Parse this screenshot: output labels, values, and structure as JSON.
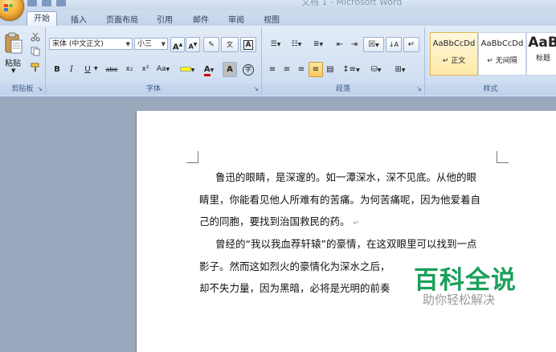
{
  "title": "文档 1 - Microsoft Word",
  "tabs": [
    "开始",
    "插入",
    "页面布局",
    "引用",
    "邮件",
    "审阅",
    "视图"
  ],
  "clipboard": {
    "paste": "粘贴",
    "group": "剪贴板"
  },
  "font": {
    "name": "宋体 (中文正文)",
    "size": "小三",
    "grow": "A",
    "shrink": "A",
    "bold": "B",
    "italic": "I",
    "underline": "U",
    "strike": "abe",
    "subscript": "x₂",
    "superscript": "x²",
    "change_case": "Aa",
    "font_color": "A",
    "char_shading": "A",
    "group": "字体"
  },
  "paragraph": {
    "group": "段落"
  },
  "styles": {
    "items": [
      {
        "sample": "AaBbCcDd",
        "name": "↵ 正文"
      },
      {
        "sample": "AaBbCcDd",
        "name": "↵ 无间隔"
      },
      {
        "sample": "AaB",
        "name": "标题"
      }
    ],
    "group": "样式"
  },
  "document": {
    "lines": [
      "鲁迅的眼睛，是深邃的。如一潭深水，深不见底。从他的眼",
      "睛里，你能看见他人所难有的苦痛。为何苦痛呢，因为他爱着自",
      "己的同胞，要找到治国救民的药。",
      "曾经的“我以我血荐轩辕”的豪情，在这双眼里可以找到一点",
      "影子。然而这如烈火的豪情化为深水之后，",
      "却不失力量，因为黑暗，必将是光明的前奏"
    ],
    "para_mark": "↵"
  },
  "watermark": {
    "main": "百科全说",
    "sub": "助你轻松解决"
  },
  "colors": {
    "watermark_green": "#1aa05a",
    "highlight": "#ffff00",
    "font_red": "#d00000"
  }
}
